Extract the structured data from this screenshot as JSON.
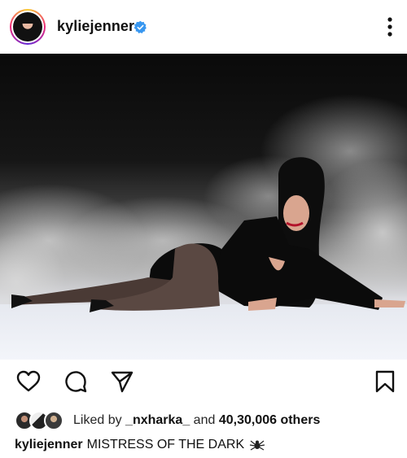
{
  "post": {
    "username": "kyliejenner",
    "verified": true,
    "caption_user": "kyliejenner",
    "caption_text": "MISTRESS OF THE DARK",
    "caption_emoji": "spider-icon"
  },
  "likes": {
    "prefix": "Liked by",
    "liker": "_nxharka_",
    "connector": "and",
    "count": "40,30,006 others"
  },
  "icons": {
    "like": "heart-icon",
    "comment": "comment-icon",
    "share": "send-icon",
    "save": "bookmark-icon",
    "more": "more-vertical-icon"
  },
  "colors": {
    "verified": "#3897f0",
    "text": "#111111",
    "background": "#ffffff"
  }
}
